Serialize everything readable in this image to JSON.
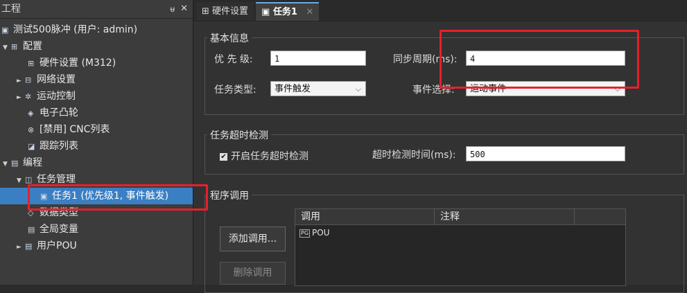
{
  "project_panel": {
    "title": "工程",
    "pin_glyph": "ᵾ",
    "close_glyph": "✕",
    "tree": [
      {
        "label": "测试500脉冲 (用户: admin)",
        "icon": "project-icon",
        "glyph": "▣",
        "arrow": ""
      },
      {
        "label": "配置",
        "icon": "config-icon",
        "glyph": "⊞",
        "arrow": "▼"
      },
      {
        "label": "硬件设置 (M312)",
        "icon": "hardware-icon",
        "glyph": "⊞",
        "arrow": ""
      },
      {
        "label": "网络设置",
        "icon": "network-icon",
        "glyph": "⊟",
        "arrow": "►"
      },
      {
        "label": "运动控制",
        "icon": "motion-icon",
        "glyph": "✲",
        "arrow": "►"
      },
      {
        "label": "电子凸轮",
        "icon": "cam-icon",
        "glyph": "◈",
        "arrow": ""
      },
      {
        "label": "[禁用] CNC列表",
        "icon": "cnc-icon",
        "glyph": "⊗",
        "arrow": ""
      },
      {
        "label": "跟踪列表",
        "icon": "trace-icon",
        "glyph": "◪",
        "arrow": ""
      },
      {
        "label": "编程",
        "icon": "programming-icon",
        "glyph": "▤",
        "arrow": "▼"
      },
      {
        "label": "任务管理",
        "icon": "task-manager-icon",
        "glyph": "◫",
        "arrow": "▼"
      },
      {
        "label": "任务1 (优先级1, 事件触发)",
        "icon": "task-icon",
        "glyph": "▣",
        "arrow": ""
      },
      {
        "label": "数据类型",
        "icon": "datatype-icon",
        "glyph": "◇",
        "arrow": ""
      },
      {
        "label": "全局变量",
        "icon": "global-var-icon",
        "glyph": "▤",
        "arrow": ""
      },
      {
        "label": "用户POU",
        "icon": "user-pou-icon",
        "glyph": "▤",
        "arrow": "►"
      }
    ]
  },
  "tabs": [
    {
      "label": "硬件设置",
      "glyph": "⊞"
    },
    {
      "label": "任务1",
      "glyph": "▣",
      "close": "✕"
    }
  ],
  "basic_info": {
    "title": "基本信息",
    "priority_label": "优 先 级:",
    "priority_value": "1",
    "sync_period_label": "同步周期(ms):",
    "sync_period_value": "4",
    "task_type_label": "任务类型:",
    "task_type_value": "事件触发",
    "event_select_label": "事件选择:",
    "event_select_value": "运动事件",
    "chevron": "⌵"
  },
  "timeout": {
    "title": "任务超时检测",
    "checkbox_mark": "✔",
    "checkbox_label": "开启任务超时检测",
    "time_label": "超时检测时间(ms):",
    "time_value": "500"
  },
  "program_call": {
    "title": "程序调用",
    "add_button": "添加调用...",
    "delete_button": "删除调用",
    "columns": [
      "调用",
      "注释"
    ],
    "rows": [
      {
        "tag": "PG",
        "name": "POU"
      }
    ]
  },
  "colors": {
    "annotation_red": "#e8202a",
    "selection_blue": "#3a7fc4"
  }
}
